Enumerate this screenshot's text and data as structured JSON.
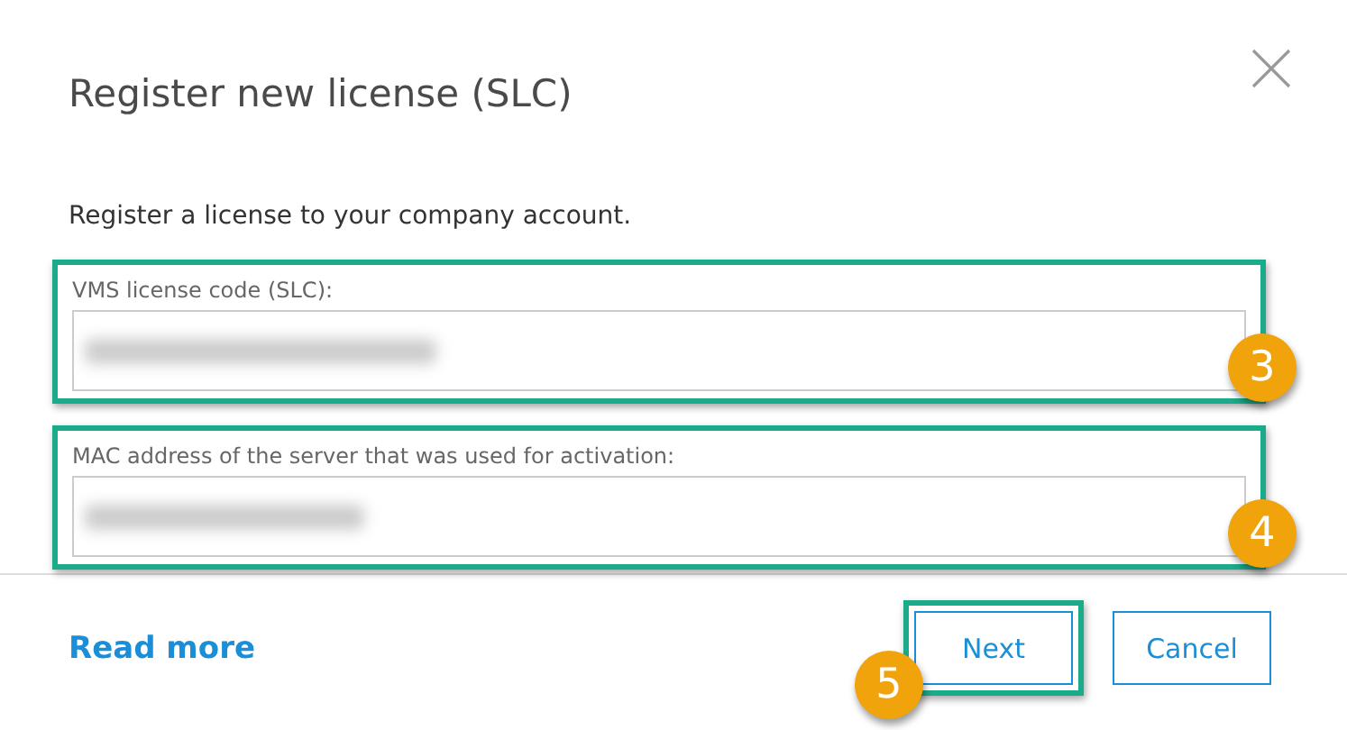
{
  "dialog": {
    "title": "Register new license (SLC)",
    "description": "Register a license to your company account.",
    "fields": [
      {
        "label": "VMS license code (SLC):",
        "highlighted": true,
        "callout": "3"
      },
      {
        "label": "MAC address of the server that was used for activation:",
        "highlighted": true,
        "callout": "4"
      }
    ],
    "footer": {
      "link": "Read more",
      "buttons": [
        {
          "label": "Next",
          "highlighted": true,
          "callout": "5"
        },
        {
          "label": "Cancel",
          "highlighted": false
        }
      ]
    }
  }
}
